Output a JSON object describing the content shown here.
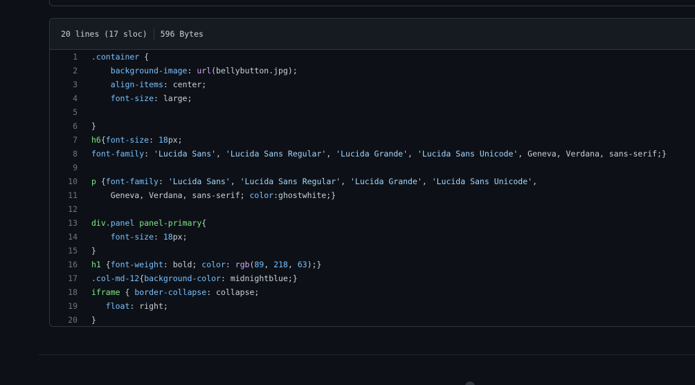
{
  "file_info": {
    "lines_label": "20 lines (17 sloc)",
    "size_label": "596 Bytes"
  },
  "code_lines": [
    [
      {
        "t": ".container",
        "c": "cls"
      },
      {
        "t": " {",
        "c": "pl"
      }
    ],
    [
      {
        "t": "    ",
        "c": "pl"
      },
      {
        "t": "background-image",
        "c": "prop"
      },
      {
        "t": ": ",
        "c": "pl"
      },
      {
        "t": "url",
        "c": "fn"
      },
      {
        "t": "(bellybutton.jpg);",
        "c": "pl"
      }
    ],
    [
      {
        "t": "    ",
        "c": "pl"
      },
      {
        "t": "align-items",
        "c": "prop"
      },
      {
        "t": ": center;",
        "c": "pl"
      }
    ],
    [
      {
        "t": "    ",
        "c": "pl"
      },
      {
        "t": "font-size",
        "c": "prop"
      },
      {
        "t": ": large;",
        "c": "pl"
      }
    ],
    [],
    [
      {
        "t": "}",
        "c": "pl"
      }
    ],
    [
      {
        "t": "h6",
        "c": "sel"
      },
      {
        "t": "{",
        "c": "pl"
      },
      {
        "t": "font-size",
        "c": "prop"
      },
      {
        "t": ": ",
        "c": "pl"
      },
      {
        "t": "18",
        "c": "num"
      },
      {
        "t": "px;",
        "c": "pl"
      }
    ],
    [
      {
        "t": "font-family",
        "c": "prop"
      },
      {
        "t": ": ",
        "c": "pl"
      },
      {
        "t": "'Lucida Sans'",
        "c": "str"
      },
      {
        "t": ", ",
        "c": "pl"
      },
      {
        "t": "'Lucida Sans Regular'",
        "c": "str"
      },
      {
        "t": ", ",
        "c": "pl"
      },
      {
        "t": "'Lucida Grande'",
        "c": "str"
      },
      {
        "t": ", ",
        "c": "pl"
      },
      {
        "t": "'Lucida Sans Unicode'",
        "c": "str"
      },
      {
        "t": ", Geneva, Verdana, sans-serif;}",
        "c": "pl"
      }
    ],
    [],
    [
      {
        "t": "p",
        "c": "sel"
      },
      {
        "t": " {",
        "c": "pl"
      },
      {
        "t": "font-family",
        "c": "prop"
      },
      {
        "t": ": ",
        "c": "pl"
      },
      {
        "t": "'Lucida Sans'",
        "c": "str"
      },
      {
        "t": ", ",
        "c": "pl"
      },
      {
        "t": "'Lucida Sans Regular'",
        "c": "str"
      },
      {
        "t": ", ",
        "c": "pl"
      },
      {
        "t": "'Lucida Grande'",
        "c": "str"
      },
      {
        "t": ", ",
        "c": "pl"
      },
      {
        "t": "'Lucida Sans Unicode'",
        "c": "str"
      },
      {
        "t": ",",
        "c": "pl"
      }
    ],
    [
      {
        "t": "    Geneva, Verdana, sans-serif; ",
        "c": "pl"
      },
      {
        "t": "color",
        "c": "prop"
      },
      {
        "t": ":ghostwhite;}",
        "c": "pl"
      }
    ],
    [],
    [
      {
        "t": "div",
        "c": "sel"
      },
      {
        "t": ".panel",
        "c": "cls"
      },
      {
        "t": " ",
        "c": "pl"
      },
      {
        "t": "panel-primary",
        "c": "sel"
      },
      {
        "t": "{",
        "c": "pl"
      }
    ],
    [
      {
        "t": "    ",
        "c": "pl"
      },
      {
        "t": "font-size",
        "c": "prop"
      },
      {
        "t": ": ",
        "c": "pl"
      },
      {
        "t": "18",
        "c": "num"
      },
      {
        "t": "px;",
        "c": "pl"
      }
    ],
    [
      {
        "t": "}",
        "c": "pl"
      }
    ],
    [
      {
        "t": "h1",
        "c": "sel"
      },
      {
        "t": " {",
        "c": "pl"
      },
      {
        "t": "font-weight",
        "c": "prop"
      },
      {
        "t": ": bold; ",
        "c": "pl"
      },
      {
        "t": "color",
        "c": "prop"
      },
      {
        "t": ": ",
        "c": "pl"
      },
      {
        "t": "rgb",
        "c": "fn"
      },
      {
        "t": "(",
        "c": "pl"
      },
      {
        "t": "89",
        "c": "num"
      },
      {
        "t": ", ",
        "c": "pl"
      },
      {
        "t": "218",
        "c": "num"
      },
      {
        "t": ", ",
        "c": "pl"
      },
      {
        "t": "63",
        "c": "num"
      },
      {
        "t": ");}",
        "c": "pl"
      }
    ],
    [
      {
        "t": ".col-md-12",
        "c": "cls"
      },
      {
        "t": "{",
        "c": "pl"
      },
      {
        "t": "background-color",
        "c": "prop"
      },
      {
        "t": ": midnightblue;}",
        "c": "pl"
      }
    ],
    [
      {
        "t": "iframe",
        "c": "sel"
      },
      {
        "t": " { ",
        "c": "pl"
      },
      {
        "t": "border-collapse",
        "c": "prop"
      },
      {
        "t": ": collapse;",
        "c": "pl"
      }
    ],
    [
      {
        "t": "   ",
        "c": "pl"
      },
      {
        "t": "float",
        "c": "prop"
      },
      {
        "t": ": right;",
        "c": "pl"
      }
    ],
    [
      {
        "t": "}",
        "c": "pl"
      }
    ]
  ]
}
